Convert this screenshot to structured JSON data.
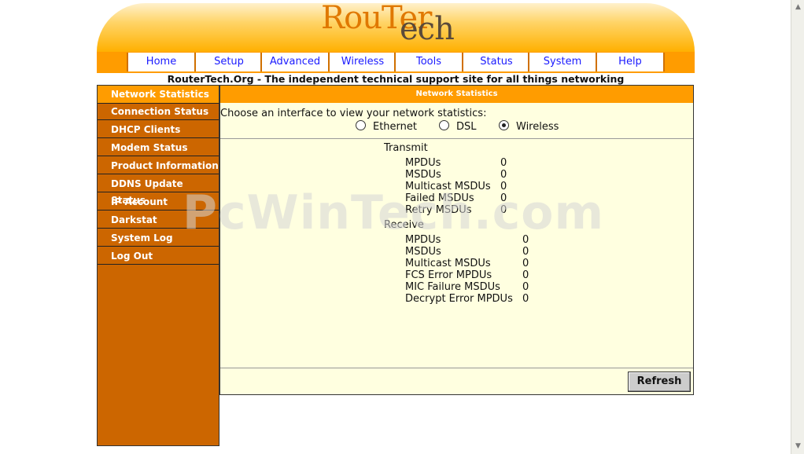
{
  "logo": {
    "part1": "Rou",
    "part2": "Ter",
    "line2": "ech"
  },
  "nav": {
    "items": [
      "Home",
      "Setup",
      "Advanced",
      "Wireless",
      "Tools",
      "Status",
      "System",
      "Help"
    ]
  },
  "tagline": "RouterTech.Org - The independent technical support site for all things networking",
  "sidebar": {
    "items": [
      "Network Statistics",
      "Connection Status",
      "DHCP Clients",
      "Modem Status",
      "Product Information",
      "DDNS Update Status",
      "IP Account",
      "Darkstat",
      "System Log",
      "Log Out"
    ]
  },
  "main": {
    "title": "Network Statistics",
    "choose_label": "Choose an interface to view your network statistics:",
    "interfaces": [
      {
        "label": "Ethernet",
        "selected": false
      },
      {
        "label": "DSL",
        "selected": false
      },
      {
        "label": "Wireless",
        "selected": true
      }
    ],
    "transmit": {
      "heading": "Transmit",
      "rows": [
        {
          "label": "MPDUs",
          "value": "0"
        },
        {
          "label": "MSDUs",
          "value": "0"
        },
        {
          "label": "Multicast MSDUs",
          "value": "0"
        },
        {
          "label": "Failed MSDUs",
          "value": "0"
        },
        {
          "label": "Retry MSDUs",
          "value": "0"
        }
      ]
    },
    "receive": {
      "heading": "Receive",
      "rows": [
        {
          "label": "MPDUs",
          "value": "0"
        },
        {
          "label": "MSDUs",
          "value": "0"
        },
        {
          "label": "Multicast MSDUs",
          "value": "0"
        },
        {
          "label": "FCS Error MPDUs",
          "value": "0"
        },
        {
          "label": "MIC Failure MSDUs",
          "value": "0"
        },
        {
          "label": "Decrypt Error MPDUs",
          "value": "0"
        }
      ]
    },
    "refresh_label": "Refresh"
  },
  "watermark": "PcWinTech.com",
  "colors": {
    "accent": "#ff9c00",
    "sidebar": "#cc6600",
    "panel": "#ffffe0",
    "link": "#1a1aff"
  }
}
